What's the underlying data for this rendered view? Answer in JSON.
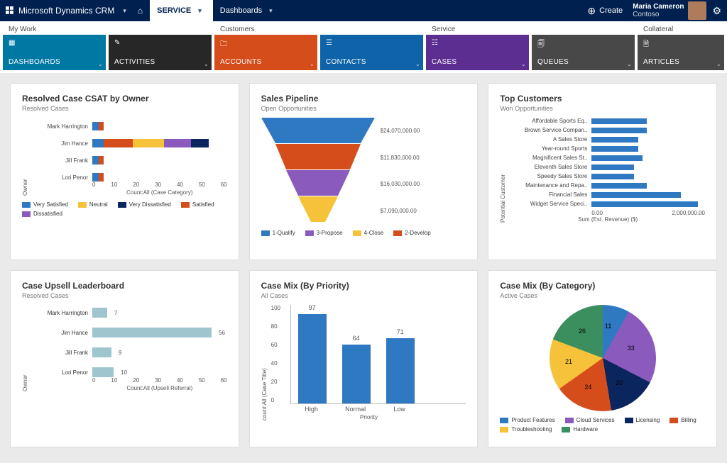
{
  "header": {
    "brand": "Microsoft Dynamics CRM",
    "nav_service": "SERVICE",
    "nav_dashboards": "Dashboards",
    "create_label": "Create",
    "user_name": "Maria Cameron",
    "user_org": "Contoso"
  },
  "work_categories": {
    "my_work": "My Work",
    "customers": "Customers",
    "service": "Service",
    "collateral": "Collateral"
  },
  "tiles": {
    "dashboards": "DASHBOARDS",
    "activities": "ACTIVITIES",
    "accounts": "ACCOUNTS",
    "contacts": "CONTACTS",
    "cases": "CASES",
    "queues": "QUEUES",
    "articles": "ARTICLES"
  },
  "cards": {
    "csat": {
      "title": "Resolved Case CSAT by Owner",
      "subtitle": "Resolved Cases",
      "y_axis": "Owner",
      "x_axis": "Count:All (Case Category)",
      "legend": [
        "Very Satisfied",
        "Neutral",
        "Very Dissatisfied",
        "Satisfied",
        "Dissatisfied"
      ]
    },
    "pipeline": {
      "title": "Sales Pipeline",
      "subtitle": "Open Opportunities",
      "legend": [
        "1-Qualify",
        "3-Propose",
        "4-Close",
        "2-Develop"
      ]
    },
    "top_customers": {
      "title": "Top Customers",
      "subtitle": "Won Opportunities",
      "y_axis": "Potential Customer",
      "x_axis": "Sum (Est. Revenue) ($)",
      "x_tick0": "0.00",
      "x_tick1": "2,000,000.00"
    },
    "upsell": {
      "title": "Case Upsell Leaderboard",
      "subtitle": "Resolved Cases",
      "y_axis": "Owner",
      "x_axis": "Count:All (Upsell Referral)"
    },
    "mix_priority": {
      "title": "Case Mix (By Priority)",
      "subtitle": "All Cases",
      "y_axis": "count:All (Case Title)",
      "x_axis": "Priority"
    },
    "mix_category": {
      "title": "Case Mix (By Category)",
      "subtitle": "Active Cases",
      "legend": [
        "Product Features",
        "Cloud Services",
        "Licensing",
        "Billing",
        "Troubleshooting",
        "Hardware"
      ]
    }
  },
  "chart_data": [
    {
      "id": "csat",
      "type": "bar",
      "orientation": "horizontal-stacked",
      "y_axis": "Owner",
      "x_axis": "Count:All (Case Category)",
      "categories": [
        "Mark Harrington",
        "Jim Hance",
        "Jill Frank",
        "Lori Penor"
      ],
      "series": [
        {
          "name": "Very Satisfied",
          "color": "#2f78c2",
          "values": [
            3,
            5,
            3,
            3
          ]
        },
        {
          "name": "Satisfied",
          "color": "#d64d1c",
          "values": [
            2,
            13,
            2,
            2
          ]
        },
        {
          "name": "Neutral",
          "color": "#f5c23a",
          "values": [
            0,
            14,
            0,
            0
          ]
        },
        {
          "name": "Dissatisfied",
          "color": "#8a5bbd",
          "values": [
            0,
            12,
            0,
            0
          ]
        },
        {
          "name": "Very Dissatisfied",
          "color": "#0b255e",
          "values": [
            0,
            8,
            0,
            0
          ]
        }
      ],
      "xlim": [
        0,
        60
      ],
      "x_ticks": [
        0,
        10,
        20,
        30,
        40,
        50,
        60
      ]
    },
    {
      "id": "pipeline",
      "type": "funnel",
      "stages": [
        {
          "name": "1-Qualify",
          "color": "#2f78c2",
          "value": 24070000,
          "label": "$24,070,000.00"
        },
        {
          "name": "2-Develop",
          "color": "#d64d1c",
          "value": 11830000,
          "label": "$11,830,000.00"
        },
        {
          "name": "3-Propose",
          "color": "#8a5bbd",
          "value": 16030000,
          "label": "$16,030,000.00"
        },
        {
          "name": "4-Close",
          "color": "#f5c23a",
          "value": 7090000,
          "label": "$7,090,000.00"
        }
      ]
    },
    {
      "id": "top_customers",
      "type": "bar",
      "orientation": "horizontal",
      "y_axis": "Potential Customer",
      "x_axis": "Sum (Est. Revenue) ($)",
      "categories": [
        "Affordable Sports Eq..",
        "Brown Service Compan..",
        "A Sales Store",
        "Year-round Sports",
        "Magnificent Sales St..",
        "Eleventh Sales Store",
        "Speedy Sales Store",
        "Maintenance and Repa..",
        "Financial Sales",
        "Widget Service Speci.."
      ],
      "values": [
        1300000,
        1300000,
        1100000,
        1100000,
        1200000,
        1000000,
        1000000,
        1300000,
        2100000,
        2500000
      ],
      "xlim": [
        0,
        2500000
      ]
    },
    {
      "id": "upsell",
      "type": "bar",
      "orientation": "horizontal",
      "y_axis": "Owner",
      "x_axis": "Count:All (Upsell Referral)",
      "categories": [
        "Mark Harrington",
        "Jim Hance",
        "Jill Frank",
        "Lori Penor"
      ],
      "values": [
        7,
        56,
        9,
        10
      ],
      "xlim": [
        0,
        60
      ],
      "x_ticks": [
        0,
        10,
        20,
        30,
        40,
        50,
        60
      ]
    },
    {
      "id": "mix_priority",
      "type": "bar",
      "orientation": "vertical",
      "x_axis": "Priority",
      "y_axis": "count:All (Case Title)",
      "categories": [
        "High",
        "Normal",
        "Low"
      ],
      "values": [
        97,
        64,
        71
      ],
      "ylim": [
        0,
        100
      ],
      "y_ticks": [
        0,
        20,
        40,
        60,
        80,
        100
      ]
    },
    {
      "id": "mix_category",
      "type": "pie",
      "slices": [
        {
          "name": "Product Features",
          "color": "#2f78c2",
          "value": 11
        },
        {
          "name": "Cloud Services",
          "color": "#8a5bbd",
          "value": 33
        },
        {
          "name": "Licensing",
          "color": "#0b255e",
          "value": 20
        },
        {
          "name": "Billing",
          "color": "#d64d1c",
          "value": 24
        },
        {
          "name": "Troubleshooting",
          "color": "#f5c23a",
          "value": 21
        },
        {
          "name": "Hardware",
          "color": "#3b8f5f",
          "value": 26
        }
      ]
    }
  ]
}
